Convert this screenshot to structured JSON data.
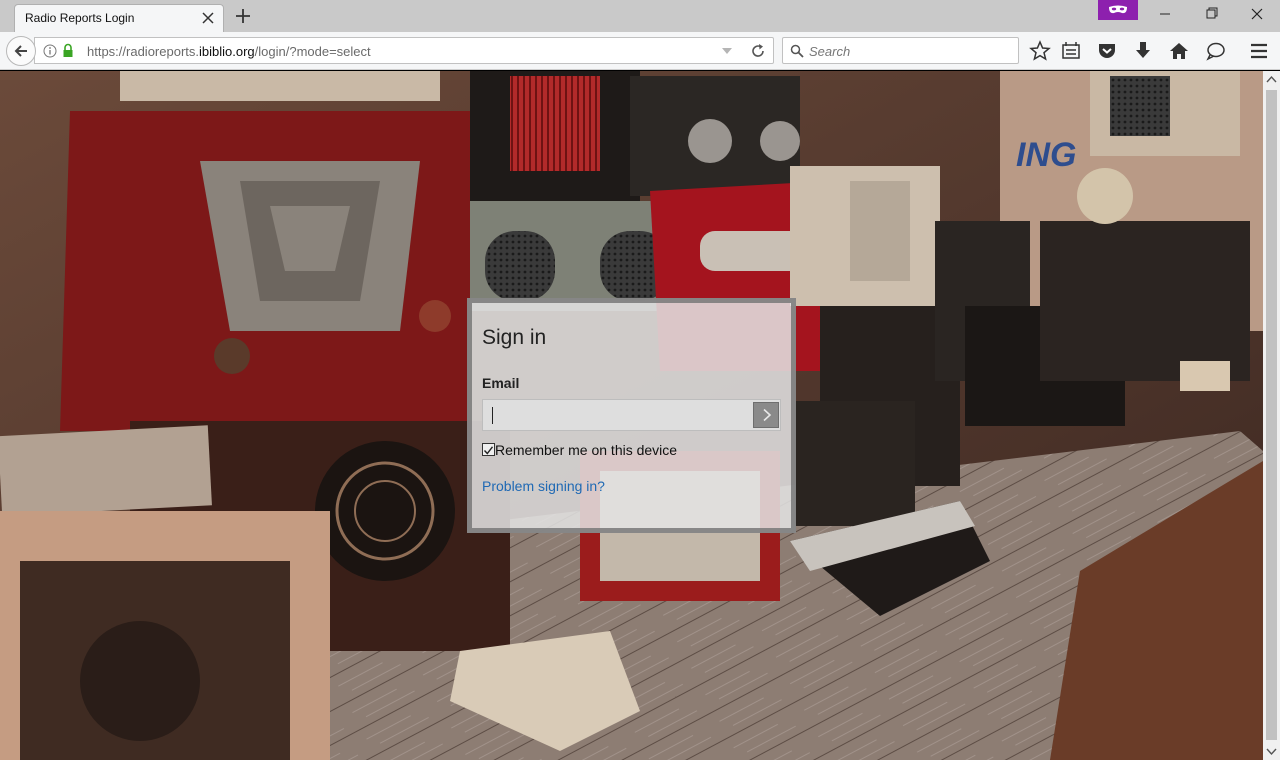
{
  "browser": {
    "tab_title": "Radio Reports Login",
    "url_prefix": "https://radioreports.",
    "url_domain": "ibiblio.org",
    "url_path": "/login/?mode=select",
    "search_placeholder": "Search",
    "private_color": "#8d20ae"
  },
  "signin": {
    "title": "Sign in",
    "email_label": "Email",
    "email_value": "",
    "remember_checked": true,
    "remember_label": "Remember me on this device",
    "problem_link": "Problem signing in?",
    "link_color": "#1f69b4"
  }
}
